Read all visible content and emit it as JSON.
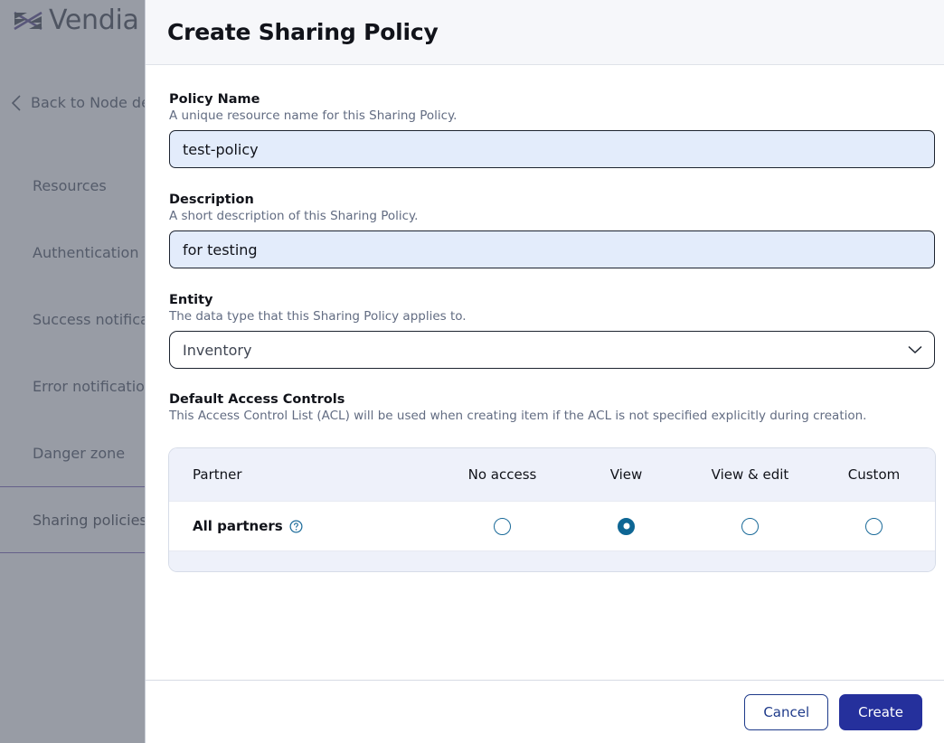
{
  "background": {
    "brand": {
      "name": "Vendia",
      "logo_icon": "vendia-logo-icon"
    },
    "back_link": {
      "label": "Back to Node de",
      "icon": "chevron-left-icon"
    },
    "nav_items": [
      {
        "label": "Resources",
        "selected": false
      },
      {
        "label": "Authentication",
        "selected": false
      },
      {
        "label": "Success notificat",
        "selected": false
      },
      {
        "label": "Error notification",
        "selected": false
      },
      {
        "label": "Danger zone",
        "selected": false
      },
      {
        "label": "Sharing policies",
        "selected": true
      }
    ]
  },
  "modal": {
    "title": "Create Sharing Policy",
    "fields": {
      "policy_name": {
        "label": "Policy Name",
        "hint": "A unique resource name for this Sharing Policy.",
        "value": "test-policy",
        "placeholder": ""
      },
      "description": {
        "label": "Description",
        "hint": "A short description of this Sharing Policy.",
        "value": "for testing",
        "placeholder": ""
      },
      "entity": {
        "label": "Entity",
        "hint": "The data type that this Sharing Policy applies to.",
        "value": "Inventory",
        "chevron_icon": "chevron-down-icon"
      }
    },
    "acl": {
      "label": "Default Access Controls",
      "hint": "This Access Control List (ACL) will be used when creating item if the ACL is not specified explicitly during creation.",
      "columns": [
        "Partner",
        "No access",
        "View",
        "View & edit",
        "Custom"
      ],
      "rows": [
        {
          "partner": "All partners",
          "help_icon": "question-circle-icon",
          "selected_option": "View",
          "options": [
            "No access",
            "View",
            "View & edit",
            "Custom"
          ]
        }
      ]
    },
    "footer": {
      "cancel_label": "Cancel",
      "create_label": "Create"
    }
  },
  "colors": {
    "accent_primary": "#25309c",
    "accent_link": "#1e3a8a",
    "radio_selected": "#0e6694",
    "input_fill": "#e3ecfb",
    "table_header": "#eef1fa",
    "overlay": "#585f6e",
    "brand_purple": "#7a63b8"
  }
}
